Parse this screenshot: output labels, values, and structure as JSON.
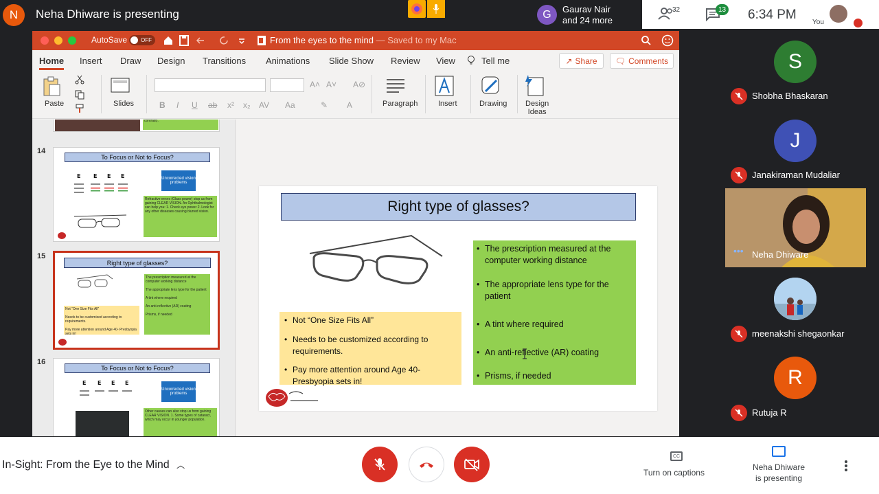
{
  "topbar": {
    "presenter_initial": "N",
    "presenting_text": "Neha Dhiware is presenting",
    "guest_initial": "G",
    "guest_line1": "Gaurav Nair",
    "guest_line2": "and 24 more",
    "people_count": "32",
    "chat_count": "13",
    "time": "6:34 PM",
    "you_label": "You"
  },
  "ppt": {
    "autosave_label": "AutoSave",
    "autosave_state": "OFF",
    "doc_title": "From the eyes to the mind",
    "doc_saved": " — Saved to my Mac",
    "tabs": [
      "Home",
      "Insert",
      "Draw",
      "Design",
      "Transitions",
      "Animations",
      "Slide Show",
      "Review",
      "View",
      "Tell me"
    ],
    "share_label": "Share",
    "comments_label": "Comments",
    "ribbon": {
      "paste": "Paste",
      "slides": "Slides",
      "paragraph": "Paragraph",
      "insert": "Insert",
      "drawing": "Drawing",
      "design_ideas_1": "Design",
      "design_ideas_2": "Ideas"
    },
    "thumbnails": {
      "s13_green": "and a SCREEN (which is variable with lesser contrast).",
      "s14_num": "14",
      "s14_title": "To Focus or Not to Focus?",
      "s14_blue": "Uncorrected vision problems",
      "s14_green": "Refractive errors (Glass power) stop us from gaining CLEAR VISION. An Ophthalmologist can help you: 1. Check eye power 2. Look for any other diseases causing blurred vision.",
      "s15_num": "15",
      "s15_title": "Right type of glasses?",
      "s16_num": "16",
      "s16_title": "To Focus or Not to Focus?",
      "s16_blue": "Uncorrected vision problems",
      "s16_green": "Other causes can also stop us from gaining CLEAR VISION. 1. Some types of cataract, which may occur in younger population."
    },
    "slide": {
      "title": "Right type of glasses?",
      "green_bullets": [
        "The prescription measured at the computer working distance",
        "The appropriate lens type for the patient",
        "A tint where required",
        "An anti-reflective (AR) coating",
        "Prisms, if needed"
      ],
      "yellow_bullets": [
        "Not  “One Size Fits All”",
        "Needs to be customized according to requirements.",
        "Pay more attention around Age 40- Presbyopia sets in!"
      ]
    }
  },
  "participants": [
    {
      "initial": "S",
      "name": "Shobha Bhaskaran",
      "color": "#2e7d32"
    },
    {
      "initial": "J",
      "name": "Janakiraman Mudaliar",
      "color": "#3f51b5"
    },
    {
      "initial": "",
      "name": "Neha Dhiware",
      "color": "#5d4037"
    },
    {
      "initial": "",
      "name": "meenakshi shegaonkar",
      "color": "#90a4ae"
    },
    {
      "initial": "R",
      "name": "Rutuja R",
      "color": "#e8590c"
    }
  ],
  "bottombar": {
    "meeting_title": "In-Sight: From the Eye to the Mind",
    "captions_label": "Turn on captions",
    "presenting_label_1": "Neha Dhiware",
    "presenting_label_2": "is presenting",
    "cc_text": "CC"
  },
  "colors": {
    "ppt_accent": "#d24726",
    "meet_dark": "#202124",
    "danger": "#d93025",
    "slide_green": "#92d050",
    "slide_yellow": "#ffe699",
    "slide_title_blue": "#b4c7e7"
  }
}
